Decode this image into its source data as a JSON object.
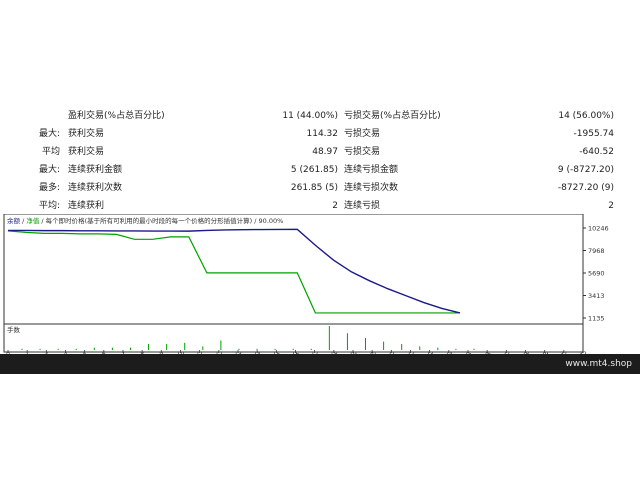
{
  "stats": {
    "rows": [
      {
        "prefix": "",
        "name1": "盈利交易(%占总百分比)",
        "val1": "11 (44.00%)",
        "name2": "亏损交易(%占总百分比)",
        "val2": "14 (56.00%)"
      },
      {
        "prefix": "最大:",
        "name1": "获利交易",
        "val1": "114.32",
        "name2": "亏损交易",
        "val2": "-1955.74"
      },
      {
        "prefix": "平均",
        "name1": "获利交易",
        "val1": "48.97",
        "name2": "亏损交易",
        "val2": "-640.52"
      },
      {
        "prefix": "最大:",
        "name1": "连续获利金额",
        "val1": "5 (261.85)",
        "name2": "连续亏损金额",
        "val2": "9 (-8727.20)"
      },
      {
        "prefix": "最多:",
        "name1": "连续获利次数",
        "val1": "261.85 (5)",
        "name2": "连续亏损次数",
        "val2": "-8727.20 (9)"
      },
      {
        "prefix": "平均:",
        "name1": "连续获利",
        "val1": "2",
        "name2": "连续亏损",
        "val2": "2"
      }
    ]
  },
  "chart": {
    "legend_balance": "余额",
    "legend_sep1": " / ",
    "legend_equity": "净值",
    "legend_rest": " / 每个即时价格(基于所有可利用的最小时段的每一个价格的分形插值计算) / 90.00%",
    "volume_label": "手数",
    "colors": {
      "balance": "#1a1a8c",
      "equity": "#00a000",
      "volume": "#00a000"
    }
  },
  "chart_data": {
    "type": "line",
    "x": [
      0,
      1,
      2,
      3,
      4,
      5,
      6,
      7,
      8,
      9,
      10,
      11,
      12,
      13,
      14,
      15,
      16,
      17,
      18,
      19,
      20,
      21,
      22,
      23,
      24,
      25
    ],
    "xticks": [
      "0",
      "1",
      "3",
      "4",
      "5",
      "6",
      "7",
      "8",
      "9",
      "10",
      "11",
      "12",
      "13",
      "14",
      "15",
      "16",
      "17",
      "18",
      "19",
      "20",
      "21",
      "22",
      "23",
      "24",
      "25",
      "26",
      "27",
      "28",
      "29",
      "31",
      "32"
    ],
    "yticks": [
      "10246",
      "7968",
      "5690",
      "3413",
      "1135"
    ],
    "ylim": [
      1135,
      10246
    ],
    "series": [
      {
        "name": "余额",
        "x": [
          0,
          1,
          2,
          3,
          4,
          5,
          6,
          7,
          8,
          9,
          10,
          11,
          12,
          13,
          14,
          15,
          16,
          17,
          18,
          19,
          20,
          21,
          22,
          23,
          24,
          25
        ],
        "values": [
          10000,
          10000,
          9980,
          9980,
          9960,
          9960,
          9950,
          9950,
          9940,
          9940,
          9930,
          10000,
          10050,
          10080,
          10090,
          10100,
          10110,
          8500,
          7000,
          5800,
          4900,
          4100,
          3400,
          2700,
          2100,
          1650
        ]
      },
      {
        "name": "净值",
        "x": [
          0,
          1,
          2,
          3,
          4,
          5,
          6,
          7,
          8,
          9,
          10,
          11,
          12,
          13,
          14,
          15,
          16,
          17,
          18,
          19,
          20,
          21,
          22,
          23,
          24,
          25
        ],
        "values": [
          9950,
          9800,
          9700,
          9700,
          9650,
          9650,
          9600,
          9100,
          9100,
          9350,
          9350,
          5700,
          5700,
          5700,
          5700,
          5700,
          5700,
          1650,
          1650,
          1650,
          1650,
          1650,
          1650,
          1650,
          1650,
          1650
        ]
      }
    ],
    "volume": [
      0.05,
      0.05,
      0.05,
      0.05,
      0.1,
      0.1,
      0.1,
      0.25,
      0.25,
      0.3,
      0.15,
      0.4,
      0.05,
      0.05,
      0.05,
      0.05,
      0.05,
      1.0,
      0.7,
      0.5,
      0.35,
      0.25,
      0.15,
      0.1,
      0.05,
      0.05
    ]
  },
  "footer": {
    "brand": "www.mt4.shop"
  }
}
